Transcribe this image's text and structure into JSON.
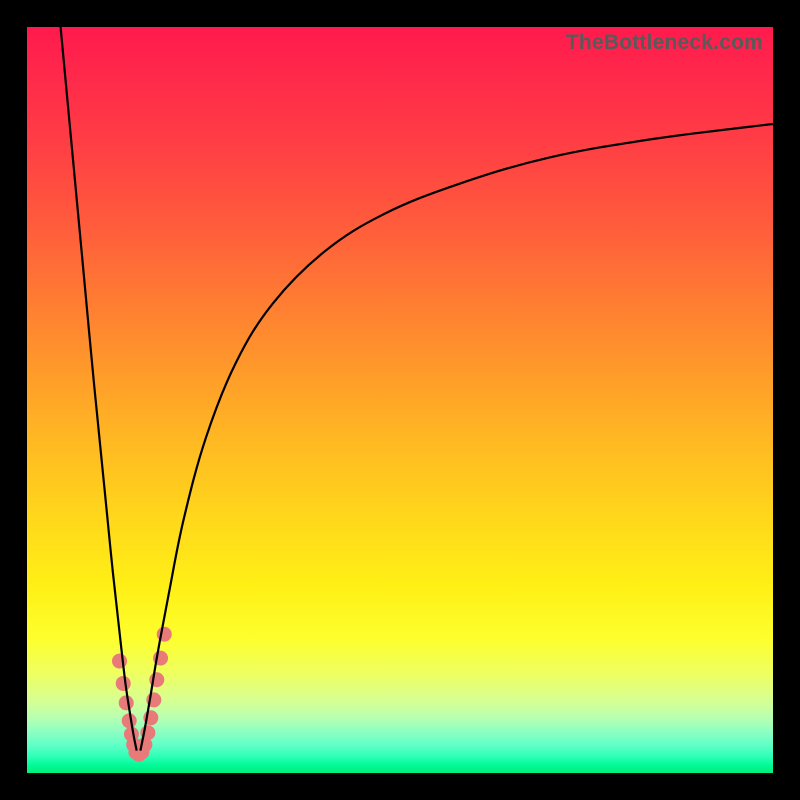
{
  "watermark": "TheBottleneck.com",
  "colors": {
    "frame": "#000000",
    "curve": "#000000",
    "marker": "#e87a7a",
    "gradient_top": "#ff1a4d",
    "gradient_bottom": "#00f07a"
  },
  "chart_data": {
    "type": "line",
    "title": "",
    "xlabel": "",
    "ylabel": "",
    "xlim": [
      0,
      100
    ],
    "ylim": [
      0,
      100
    ],
    "grid": false,
    "legend": false,
    "note": "values are approximate percentages in plot coordinates (0=left/bottom, 100=right/top); |bottleneck| curve, minimum near x≈15",
    "series": [
      {
        "name": "left-branch",
        "x": [
          4.5,
          6,
          7.5,
          9,
          10.5,
          11.5,
          12.5,
          13.2,
          13.8,
          14.3,
          14.7
        ],
        "y": [
          100,
          84,
          68,
          52,
          37,
          27,
          18,
          12,
          8,
          5,
          3
        ]
      },
      {
        "name": "right-branch",
        "x": [
          15.2,
          15.8,
          16.5,
          17.5,
          19,
          21,
          24,
          28,
          33,
          40,
          48,
          58,
          70,
          84,
          100
        ],
        "y": [
          3,
          6,
          10,
          16,
          24,
          34,
          45,
          55,
          63,
          70,
          75,
          79,
          82.5,
          85,
          87
        ]
      }
    ],
    "markers": {
      "name": "highlighted-points",
      "note": "salmon points clustered around the minimum of the V",
      "x": [
        12.4,
        12.9,
        13.3,
        13.7,
        14.0,
        14.3,
        14.6,
        15.0,
        15.4,
        15.8,
        16.2,
        16.6,
        17.0,
        17.4,
        17.9,
        18.4
      ],
      "y": [
        15.0,
        12.0,
        9.4,
        7.0,
        5.2,
        3.8,
        2.8,
        2.5,
        2.8,
        3.8,
        5.4,
        7.4,
        9.8,
        12.5,
        15.4,
        18.6
      ]
    },
    "minimum": {
      "x": 15,
      "y": 2.5
    }
  }
}
